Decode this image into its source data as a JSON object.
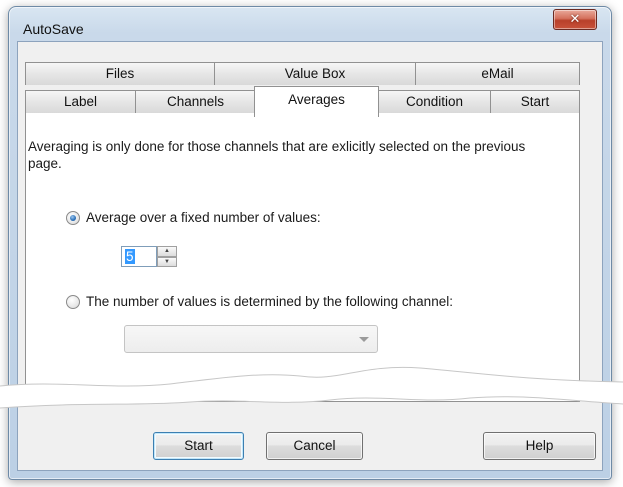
{
  "window": {
    "title": "AutoSave"
  },
  "tabs": {
    "row1": [
      "Files",
      "Value Box",
      "eMail"
    ],
    "row2": [
      "Label",
      "Channels",
      "Averages",
      "Condition",
      "Start"
    ],
    "active": "Averages"
  },
  "panel": {
    "description": "Averaging is only done for those channels that are exlicitly selected on the previous page.",
    "option_fixed": {
      "label": "Average over a fixed number of values:",
      "checked": true
    },
    "count_value": "5",
    "option_channel": {
      "label": "The number of values is determined by the following channel:",
      "checked": false
    },
    "channel_select": {
      "value": "",
      "enabled": false
    }
  },
  "buttons": {
    "start": "Start",
    "cancel": "Cancel",
    "help": "Help"
  },
  "icons": {
    "close": "close-icon",
    "spin_up": "spin-up-icon",
    "spin_down": "spin-down-icon",
    "combo": "chevron-down-icon"
  }
}
